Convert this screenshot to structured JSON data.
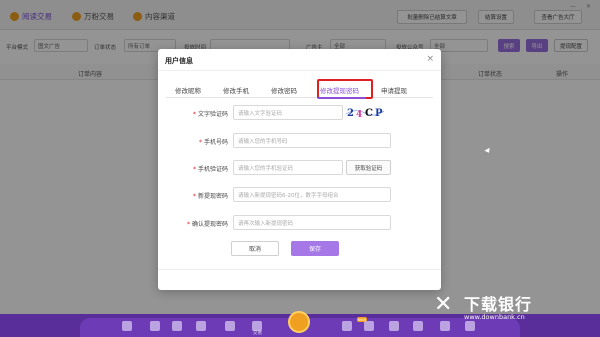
{
  "topbar": {
    "tabs": [
      {
        "label": "阅读交易",
        "active": true
      },
      {
        "label": "万粉交易",
        "active": false
      },
      {
        "label": "内容渠道",
        "active": false
      }
    ],
    "buttons": [
      {
        "label": "批量删除已结算文章"
      },
      {
        "label": "结算设置"
      },
      {
        "label": "查看广告大厅"
      }
    ]
  },
  "filters": {
    "platform_label": "平台模式",
    "platform_value": "图文广告",
    "order_status_label": "订单状态",
    "order_status_value": "所有订单",
    "time_label": "投放时间",
    "time_value": "",
    "advertiser_label": "广告主",
    "advertiser_value": "全部",
    "account_label": "投放公众号",
    "account_value": "全部",
    "search_btn": "搜索",
    "export_btn": "导出",
    "extract_btn": "提现配置"
  },
  "table": {
    "headers": [
      "订单内容",
      "订单状态",
      "操作"
    ]
  },
  "modal": {
    "title": "用户信息",
    "close": "×",
    "tabs": [
      {
        "label": "修改昵称",
        "active": false
      },
      {
        "label": "修改手机",
        "active": false
      },
      {
        "label": "修改密码",
        "active": false
      },
      {
        "label": "修改提现密码",
        "active": true
      },
      {
        "label": "申请提现",
        "active": false
      }
    ],
    "fields": [
      {
        "label": "文字验证码",
        "placeholder": "请输入文字验证码",
        "required": true
      },
      {
        "label": "手机号码",
        "placeholder": "请输入您的手机号码",
        "required": true
      },
      {
        "label": "手机验证码",
        "placeholder": "请输入您的手机验证码",
        "required": true
      },
      {
        "label": "新提现密码",
        "placeholder": "请输入新提现密码6-20位，数字字母组合",
        "required": true
      },
      {
        "label": "确认提现密码",
        "placeholder": "请再次输入新提现密码",
        "required": true
      }
    ],
    "captcha_text": "2 4 C P",
    "get_code_btn": "获取验证码",
    "cancel_btn": "取消",
    "save_btn": "保存"
  },
  "dock": {
    "labels": [
      "交易"
    ],
    "badge": "NEW"
  },
  "watermark": {
    "logo": "✕",
    "name": "下载银行",
    "url": "www.downbank.cn"
  },
  "colors": {
    "accent": "#8a4fd6",
    "highlight": "#e02020",
    "dock": "#5a2e9a"
  }
}
